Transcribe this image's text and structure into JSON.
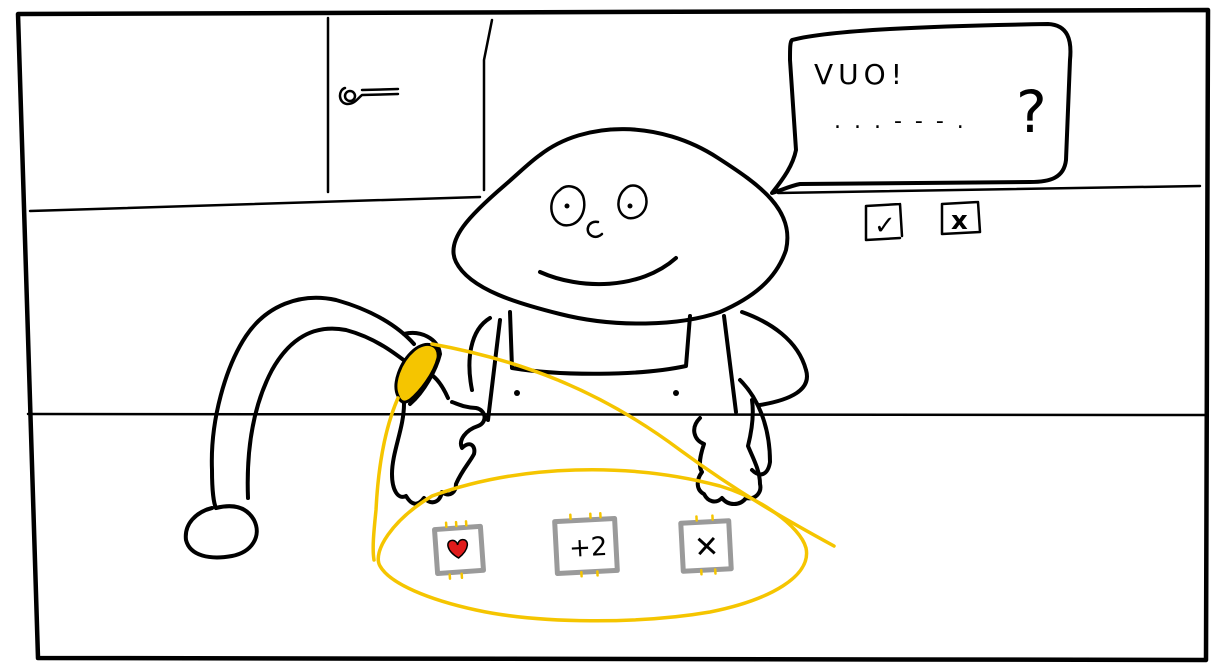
{
  "speech_bubble": {
    "text": "VUO!",
    "ellipsis": ". . . - - - .",
    "question_mark": "?"
  },
  "reply_options": {
    "accept_label": "✓",
    "reject_label": "x"
  },
  "cards": [
    {
      "id": "heart",
      "label": "♥"
    },
    {
      "id": "plus-two",
      "label": "+2"
    },
    {
      "id": "cross",
      "label": "✕"
    }
  ],
  "colors": {
    "ink": "#000000",
    "highlight": "#f5c500",
    "heart": "#e01b1b",
    "card_frame": "#9a9a9a"
  }
}
